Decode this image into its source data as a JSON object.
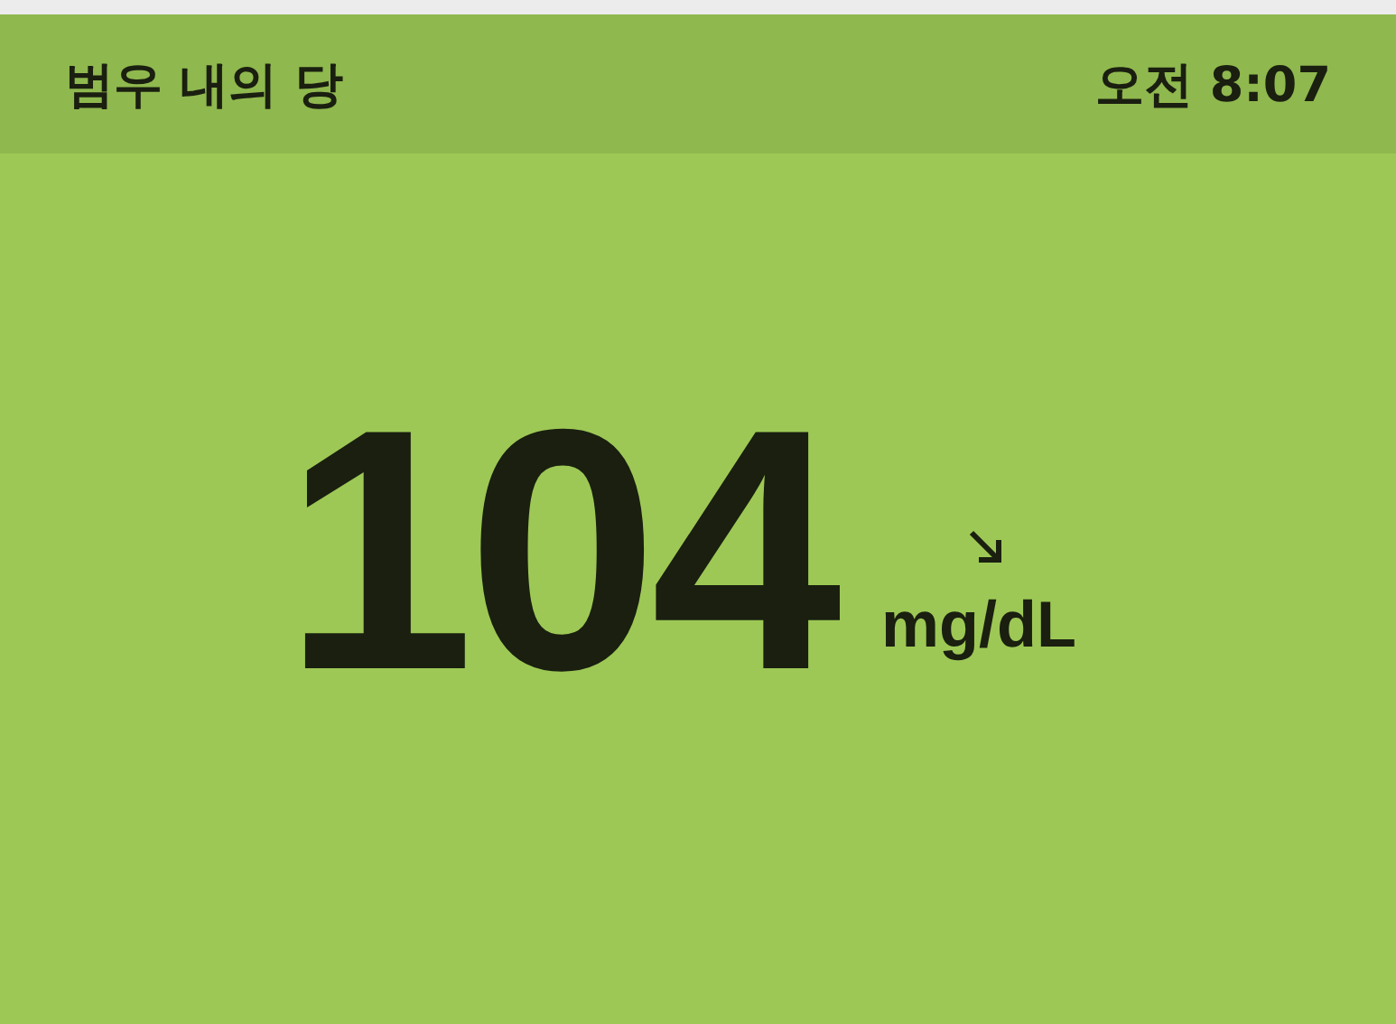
{
  "header": {
    "title": "범우 내의 당",
    "time": "오전 8:07"
  },
  "reading": {
    "value": "104",
    "unit": "mg/dL"
  }
}
